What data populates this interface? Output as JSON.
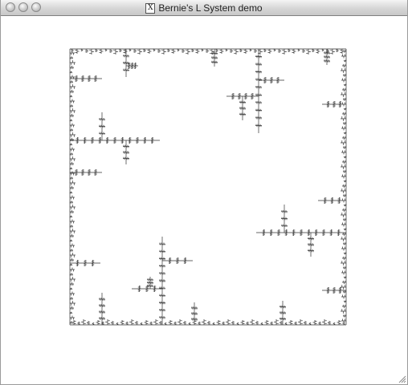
{
  "window": {
    "title": "Bernie's L System demo",
    "title_icon": "X"
  },
  "colors": {
    "fractal_stroke": "#333333",
    "background": "#ffffff"
  }
}
